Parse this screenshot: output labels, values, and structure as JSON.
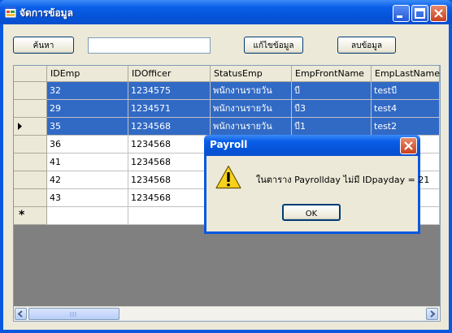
{
  "window": {
    "title": "จัดการข้อมูล"
  },
  "toolbar": {
    "search_label": "ค้นหา",
    "search_value": "",
    "edit_label": "แก้ไขข้อมูล",
    "delete_label": "ลบข้อมูล"
  },
  "grid": {
    "columns": [
      "IDEmp",
      "IDOfficer",
      "StatusEmp",
      "EmpFrontName",
      "EmpLastName"
    ],
    "rows": [
      {
        "cells": [
          "32",
          "1234575",
          "พนักงานรายวัน",
          "บี",
          "testบี"
        ],
        "selected": true,
        "current": false
      },
      {
        "cells": [
          "29",
          "1234571",
          "พนักงานรายวัน",
          "บี3",
          "test4"
        ],
        "selected": true,
        "current": false
      },
      {
        "cells": [
          "35",
          "1234568",
          "พนักงานรายวัน",
          "บี1",
          "test2"
        ],
        "selected": true,
        "current": true
      },
      {
        "cells": [
          "36",
          "1234568",
          "",
          "",
          ""
        ],
        "selected": false,
        "current": false
      },
      {
        "cells": [
          "41",
          "1234568",
          "",
          "",
          ""
        ],
        "selected": false,
        "current": false
      },
      {
        "cells": [
          "42",
          "1234568",
          "",
          "",
          ""
        ],
        "selected": false,
        "current": false
      },
      {
        "cells": [
          "43",
          "1234568",
          "",
          "",
          ""
        ],
        "selected": false,
        "current": false
      }
    ],
    "new_row_marker": "*"
  },
  "dialog": {
    "title": "Payroll",
    "message": "ในตาราง Payrollday ไม่มี IDpayday = 21",
    "ok_label": "OK",
    "icon": "warning-icon"
  },
  "colors": {
    "titlebar": "#0a58e0",
    "selection": "#316ac5",
    "grid_background": "#808080"
  }
}
